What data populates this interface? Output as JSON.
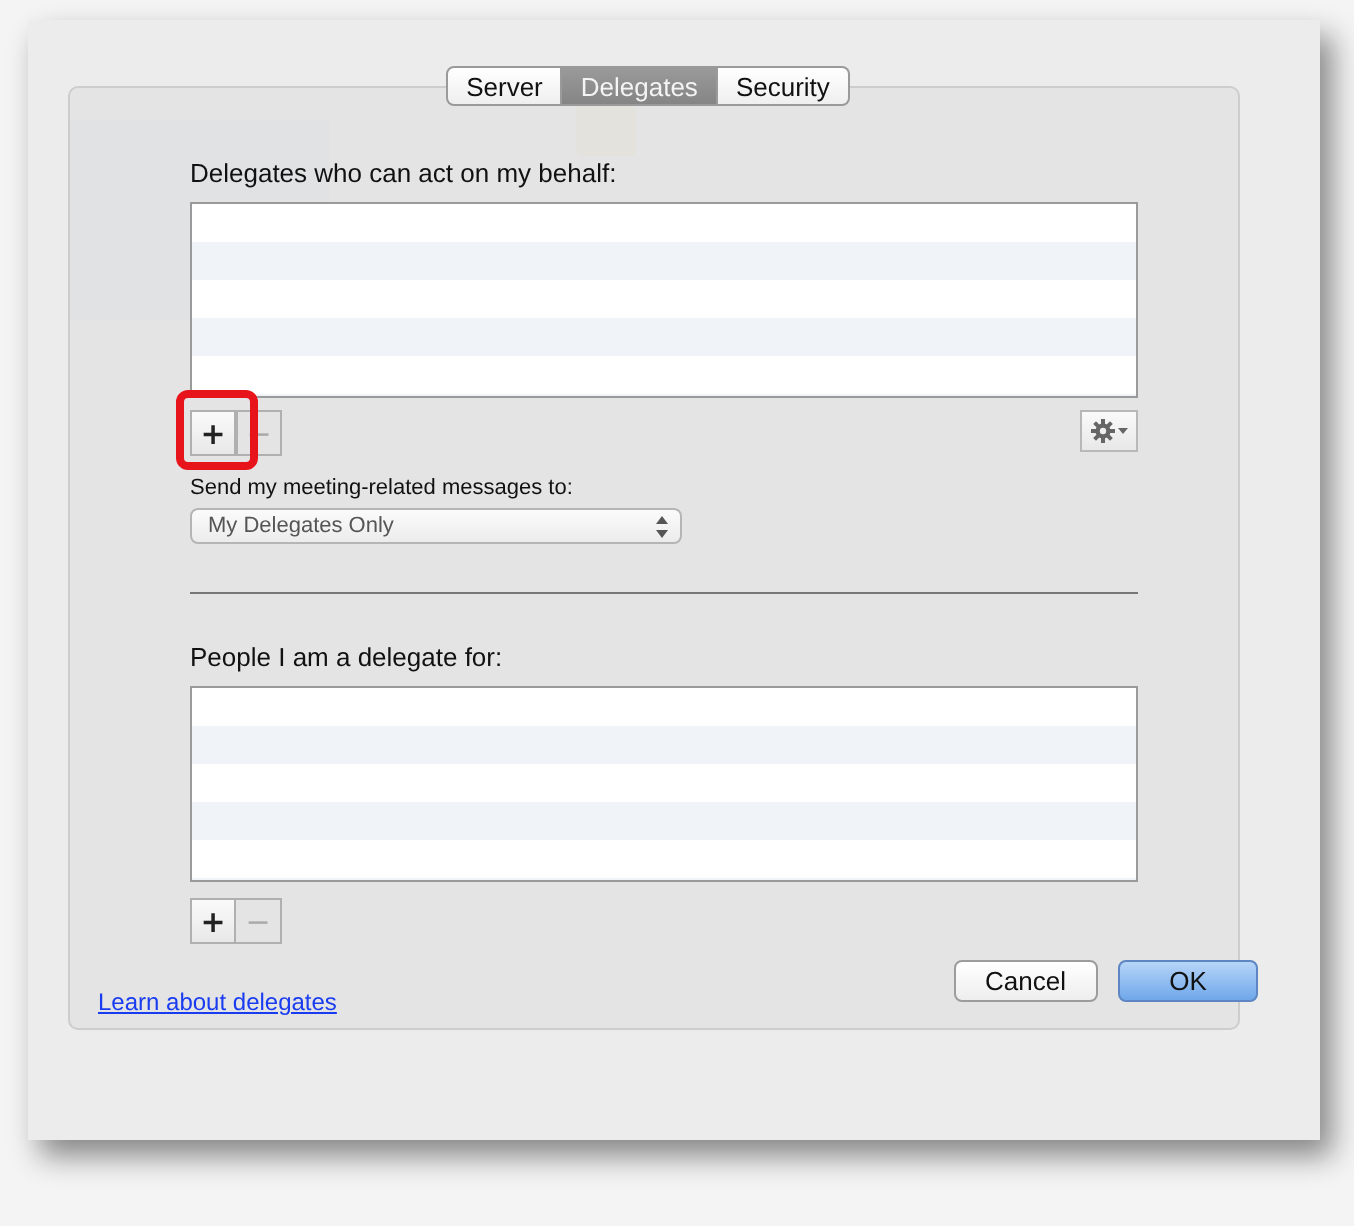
{
  "tabs": [
    {
      "label": "Server",
      "selected": false
    },
    {
      "label": "Delegates",
      "selected": true
    },
    {
      "label": "Security",
      "selected": false
    }
  ],
  "delegates_section": {
    "label": "Delegates who can act on my behalf:",
    "add_button": {
      "text": "+",
      "disabled": false,
      "highlighted": true
    },
    "remove_button": {
      "text": "−",
      "disabled": true
    }
  },
  "send_to": {
    "label": "Send my meeting-related messages to:",
    "value": "My Delegates Only"
  },
  "people_section": {
    "label": "People I am a delegate for:",
    "add_button": {
      "text": "+",
      "disabled": false
    },
    "remove_button": {
      "text": "−",
      "disabled": true
    }
  },
  "link": "Learn about delegates",
  "buttons": [
    {
      "label": "Cancel",
      "default": false
    },
    {
      "label": "OK",
      "default": true
    }
  ]
}
